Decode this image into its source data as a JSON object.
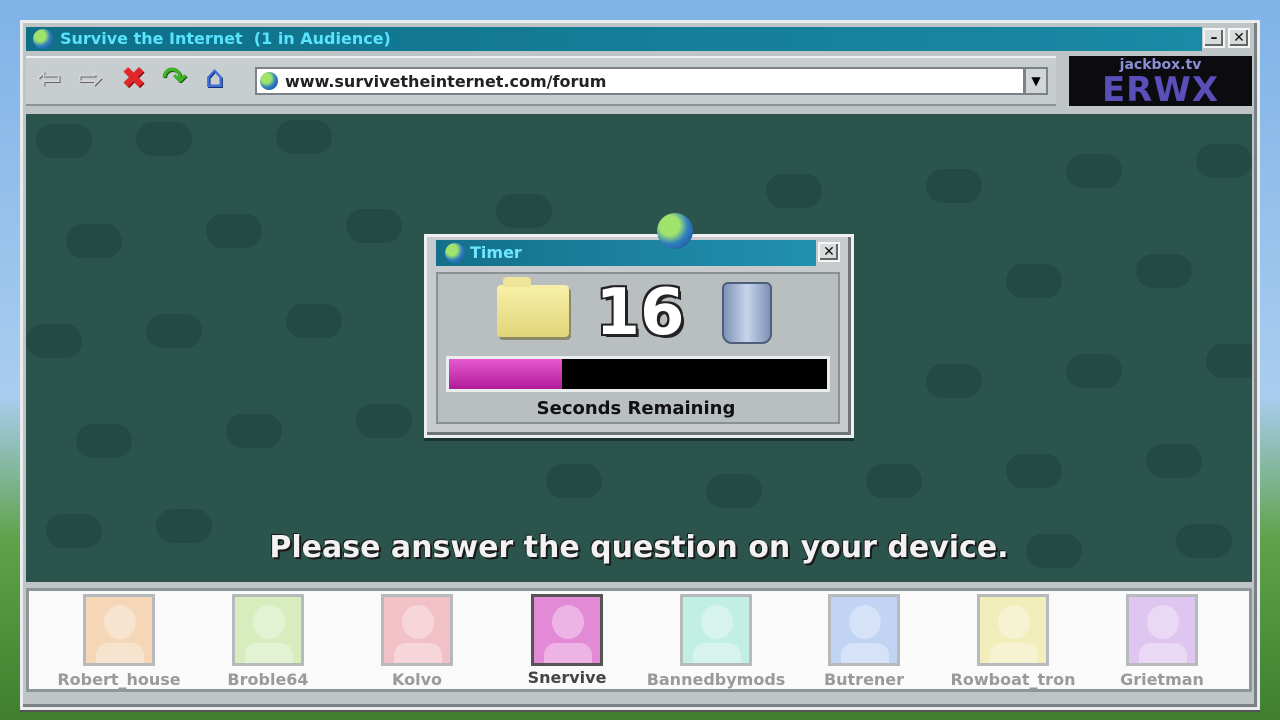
{
  "window": {
    "title": "Survive the Internet  (1 in Audience)",
    "minimize_label": "–",
    "close_label": "✕"
  },
  "toolbar": {
    "back_icon": "back-arrow-icon",
    "forward_icon": "forward-arrow-icon",
    "stop_icon": "stop-x-icon",
    "refresh_icon": "refresh-arrow-icon",
    "home_icon": "home-icon",
    "url": "www.survivetheinternet.com/forum",
    "dropdown_glyph": "▼"
  },
  "room": {
    "site": "jackbox.tv",
    "code": "ERWX"
  },
  "timer": {
    "title": "Timer",
    "close_label": "✕",
    "seconds": "16",
    "progress_fraction": 0.3,
    "label": "Seconds Remaining"
  },
  "prompt": "Please answer the question on your device.",
  "players": [
    {
      "name": "Robert_house",
      "color": "#f3c89a",
      "active": false
    },
    {
      "name": "Broble64",
      "color": "#c9e8a6",
      "active": false
    },
    {
      "name": "Kolvo",
      "color": "#f0aab3",
      "active": false
    },
    {
      "name": "Snervive",
      "color": "#e38ad6",
      "active": true
    },
    {
      "name": "Bannedbymods",
      "color": "#a9ecd8",
      "active": false
    },
    {
      "name": "Butrener",
      "color": "#a9c4f2",
      "active": false
    },
    {
      "name": "Rowboat_tron",
      "color": "#eeeaa1",
      "active": false
    },
    {
      "name": "Grietman",
      "color": "#d4b1ee",
      "active": false
    }
  ]
}
